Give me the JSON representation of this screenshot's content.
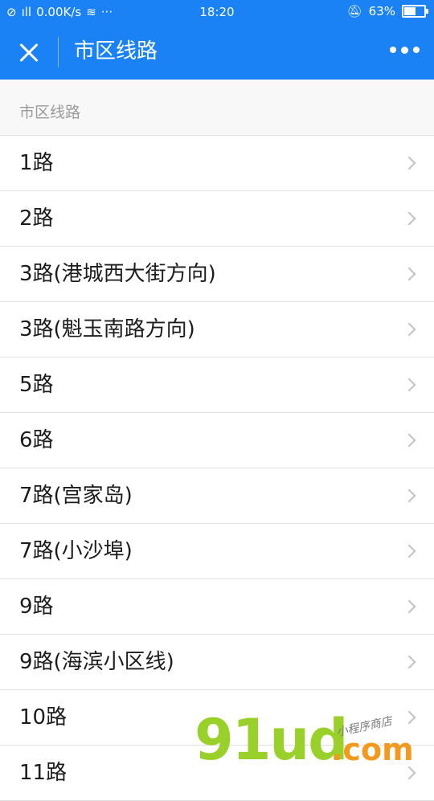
{
  "status_bar": {
    "left_icons": [
      "dnd-icon",
      "signal-icon"
    ],
    "network_speed": "0.00K/s",
    "time": "18:20",
    "battery_percent": "63%",
    "battery_level": 0.63
  },
  "nav": {
    "title": "市区线路"
  },
  "section": {
    "header": "市区线路"
  },
  "routes": [
    {
      "label": "1路"
    },
    {
      "label": "2路"
    },
    {
      "label": "3路(港城西大街方向)"
    },
    {
      "label": "3路(魁玉南路方向)"
    },
    {
      "label": "5路"
    },
    {
      "label": "6路"
    },
    {
      "label": "7路(宫家岛)"
    },
    {
      "label": "7路(小沙埠)"
    },
    {
      "label": "9路"
    },
    {
      "label": "9路(海滨小区线)"
    },
    {
      "label": "10路"
    },
    {
      "label": "11路"
    }
  ],
  "watermark": {
    "brand": "91ud",
    "domain": ".com",
    "tagline": "小程序商店"
  },
  "colors": {
    "primary": "#1a82f5",
    "watermark_green": "#99d12a",
    "watermark_orange": "#f39a1e"
  }
}
